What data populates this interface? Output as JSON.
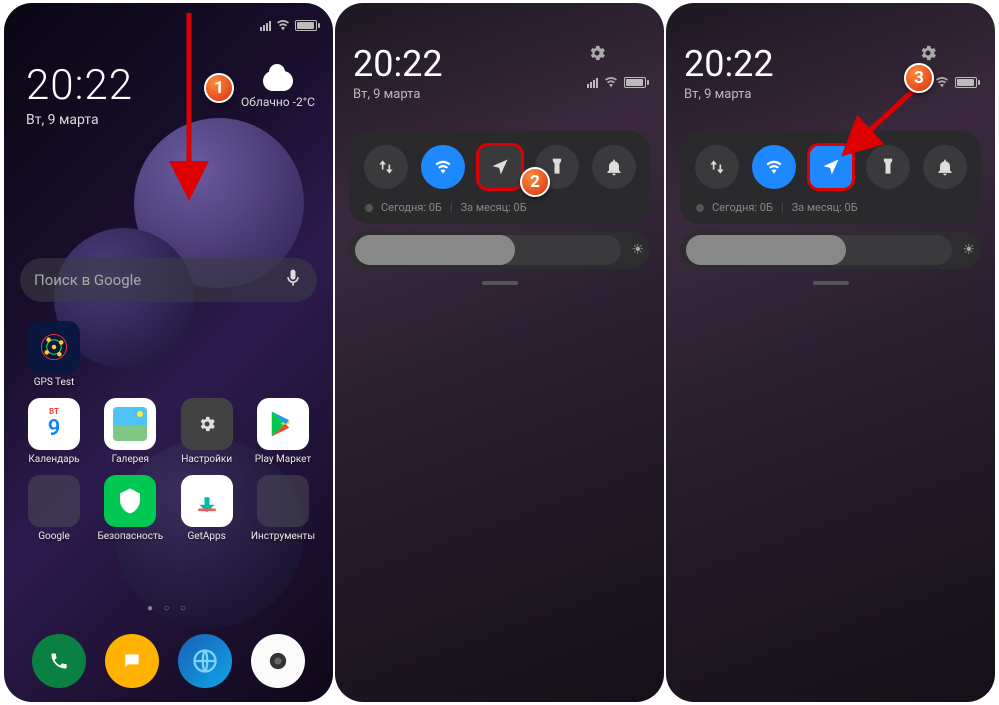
{
  "status": {
    "time": "20:22",
    "date": "Вт, 9 марта"
  },
  "weather": {
    "label": "Облачно",
    "temp": "-2°C"
  },
  "search": {
    "placeholder": "Поиск в Google"
  },
  "apps": {
    "row0": [
      {
        "label": "GPS Test"
      }
    ],
    "row1": [
      {
        "label": "Календарь",
        "day": "9"
      },
      {
        "label": "Галерея"
      },
      {
        "label": "Настройки"
      },
      {
        "label": "Play Маркет"
      }
    ],
    "row2": [
      {
        "label": "Google"
      },
      {
        "label": "Безопасность"
      },
      {
        "label": "GetApps"
      },
      {
        "label": "Инструменты"
      }
    ]
  },
  "qs": {
    "usage_today_label": "Сегодня: 0Б",
    "usage_month_label": "За месяц: 0Б"
  },
  "markers": {
    "m1": "1",
    "m2": "2",
    "m3": "3"
  }
}
